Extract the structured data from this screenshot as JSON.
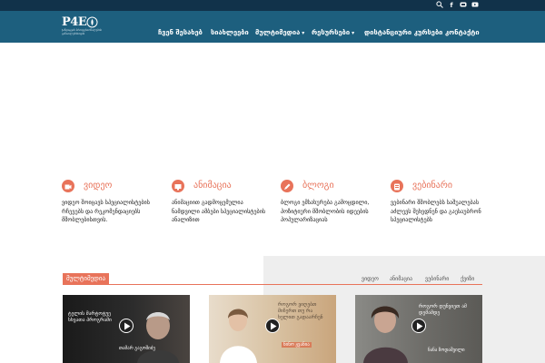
{
  "topbar": {
    "icons": [
      "search-icon",
      "facebook-icon",
      "email-icon",
      "youtube-icon"
    ],
    "bg_color": "#11324a"
  },
  "header": {
    "bg_color": "#1d5f7e",
    "logo": {
      "title": "P4E",
      "subtitle": "ჯანდაცვის პროფესიონალების განათლებისთვის"
    },
    "nav": [
      {
        "label": "ჩვენ შესახებ",
        "has_dropdown": false
      },
      {
        "label": "სიახლეები",
        "has_dropdown": false
      },
      {
        "label": "მულტიმედია",
        "has_dropdown": true
      },
      {
        "label": "რესურსები",
        "has_dropdown": true
      },
      {
        "label": "დისტანციური კურსები",
        "has_dropdown": false
      },
      {
        "label": "კონტაქტი",
        "has_dropdown": false
      }
    ]
  },
  "features": [
    {
      "icon": "video-icon",
      "title": "ვიდეო",
      "desc": "ვიდეო შოიცავს სპეციალისტების რჩევებს და რეკომენდაციებს მშობლებისთვის."
    },
    {
      "icon": "animation-icon",
      "title": "ანიმაცია",
      "desc": "ანიმაციით გადმოცემულია ნამდვილი ამბები სპეციალისტების ანალიზით"
    },
    {
      "icon": "pen-icon",
      "title": "ბლოგი",
      "desc": "ბლოგი ემსახურება გამოცდილი, პოზიტიური მშობლობის იდეების პოპულარიზაციას"
    },
    {
      "icon": "webinar-icon",
      "title": "ვებინარი",
      "desc": "ვებინარი შშობლებს საშუალებას აძლევს შეხვდნენ და გაესაუბრონ სპეციალისტებს"
    }
  ],
  "multimedia": {
    "label": "მულტიმედია",
    "tabs": [
      "ვიდეო",
      "ანიმაცია",
      "ვებინარი",
      "ქვიზი"
    ],
    "videos": [
      {
        "caption": "ტელის მარტოტუე სხვათა პროგრამი",
        "name": "თამარ გაგოშიძე"
      },
      {
        "caption": "როგორ ვიღებთ მიჩერთ თუ რა ხელით გადაარჩენ",
        "name": "ნინო ჟვანია"
      },
      {
        "caption": "როგორ დუნვიეთ ამ დემამდე",
        "name": "ნანა ზოდაშვილი"
      }
    ]
  },
  "colors": {
    "accent": "#e8735a",
    "panel": "#eeeeee"
  }
}
